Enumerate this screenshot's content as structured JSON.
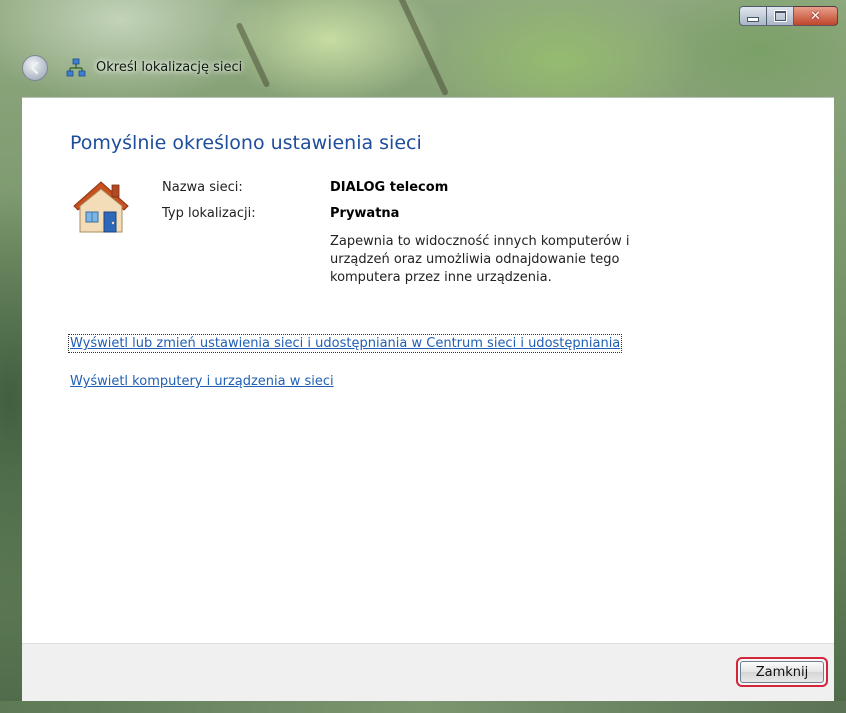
{
  "window": {
    "title": "Określ lokalizację sieci",
    "controls": {
      "minimize": "–",
      "maximize": "□",
      "close": "✕"
    }
  },
  "nav": {
    "back_icon": "back-arrow-icon",
    "network_icon": "network-icon"
  },
  "content": {
    "heading": "Pomyślnie określono ustawienia sieci",
    "icon": "house-icon",
    "network_name_label": "Nazwa sieci:",
    "network_name_value": "DIALOG telecom",
    "location_type_label": "Typ lokalizacji:",
    "location_type_value": "Prywatna",
    "description": "Zapewnia to widoczność innych komputerów i urządzeń oraz umożliwia odnajdowanie tego komputera przez inne urządzenia.",
    "links": [
      "Wyświetl lub zmień ustawienia sieci i udostępniania w Centrum sieci i udostępniania",
      "Wyświetl komputery i urządzenia w sieci"
    ]
  },
  "footer": {
    "close_label": "Zamknij"
  },
  "colors": {
    "heading": "#1e4d9c",
    "link": "#1f5fb5",
    "close_highlight": "#d4263a"
  }
}
